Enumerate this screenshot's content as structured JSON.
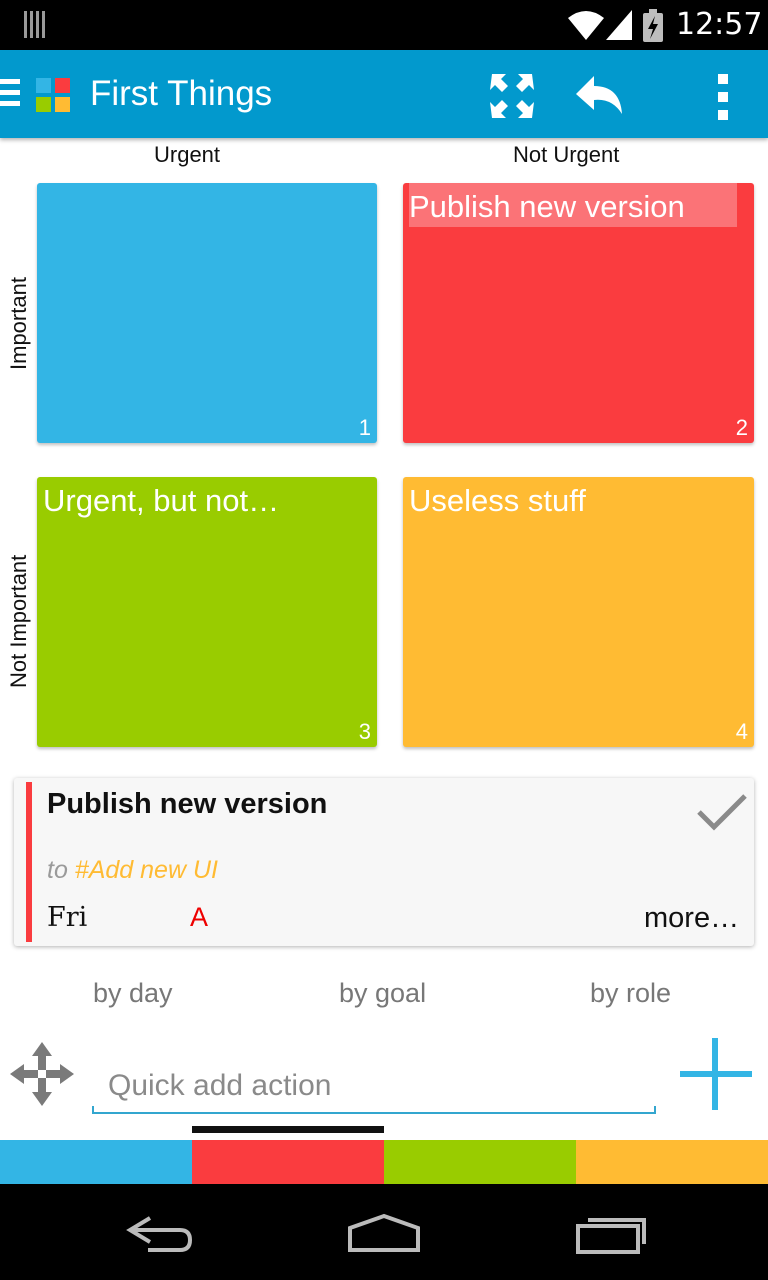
{
  "status_bar": {
    "time": "12:57"
  },
  "app": {
    "title": "First Things"
  },
  "matrix": {
    "col_labels": [
      "Urgent",
      "Not Urgent"
    ],
    "row_labels": [
      "Important",
      "Not Important"
    ],
    "quadrants": [
      {
        "number": "1",
        "title": "",
        "color": "#33b5e5"
      },
      {
        "number": "2",
        "title": "Publish new version",
        "color": "#fa3c3f"
      },
      {
        "number": "3",
        "title": "Urgent, but not…",
        "color": "#99cc00"
      },
      {
        "number": "4",
        "title": "Useless stuff",
        "color": "#ffbb33"
      }
    ]
  },
  "detail": {
    "title": "Publish new version",
    "to_prefix": "to",
    "goal": "#Add new UI",
    "day": "Fri",
    "priority": "A",
    "more_label": "more…"
  },
  "views": {
    "by_day": "by day",
    "by_goal": "by goal",
    "by_role": "by role"
  },
  "quick_add": {
    "placeholder": "Quick add action"
  },
  "colors": {
    "accent": "#0299cd",
    "strip": [
      "#33b5e5",
      "#fa3c3f",
      "#99cc00",
      "#ffbb33"
    ]
  },
  "icons": {
    "expand": "expand-icon",
    "undo": "undo-icon",
    "overflow": "overflow-menu-icon",
    "move": "move-icon",
    "add": "plus-icon",
    "check": "check-icon"
  }
}
